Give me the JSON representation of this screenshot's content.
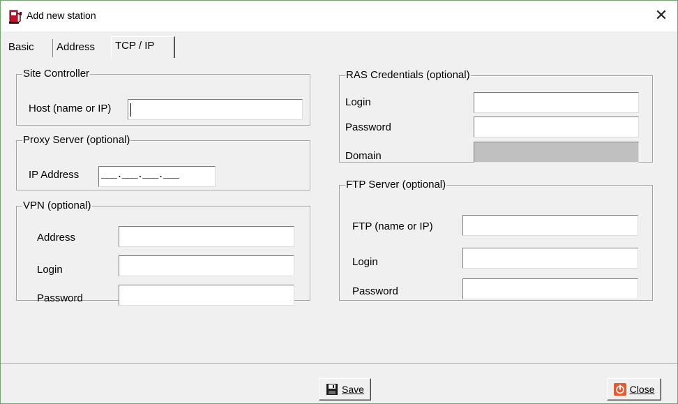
{
  "window": {
    "title": "Add new station",
    "icon": "fuel-pump-icon",
    "close_glyph": "✕"
  },
  "tabs": [
    {
      "label": "Basic",
      "active": false
    },
    {
      "label": "Address",
      "active": false
    },
    {
      "label": "TCP / IP",
      "active": true
    }
  ],
  "site_controller": {
    "legend": "Site Controller",
    "host_label": "Host (name or IP)",
    "host_value": ""
  },
  "proxy": {
    "legend": "Proxy Server (optional)",
    "ip_label": "IP Address",
    "ip_mask": "___.___.___.___"
  },
  "vpn": {
    "legend": "VPN (optional)",
    "address_label": "Address",
    "login_label": "Login",
    "password_label": "Password",
    "address_value": "",
    "login_value": "",
    "password_value": ""
  },
  "ras": {
    "legend": "RAS Credentials (optional)",
    "login_label": "Login",
    "password_label": "Password",
    "domain_label": "Domain",
    "login_value": "",
    "password_value": "",
    "domain_value": ""
  },
  "ftp": {
    "legend": "FTP Server (optional)",
    "ftp_label": "FTP  (name or IP)",
    "login_label": "Login",
    "password_label": "Password",
    "ftp_value": "",
    "login_value": "",
    "password_value": ""
  },
  "buttons": {
    "save_label": "Save",
    "save_icon": "floppy-disk-icon",
    "close_label": "Close",
    "close_icon": "power-icon"
  },
  "colors": {
    "window_border": "#6fa36f",
    "close_icon_bg": "#e8582a",
    "fuel_icon": "#c8102e"
  }
}
